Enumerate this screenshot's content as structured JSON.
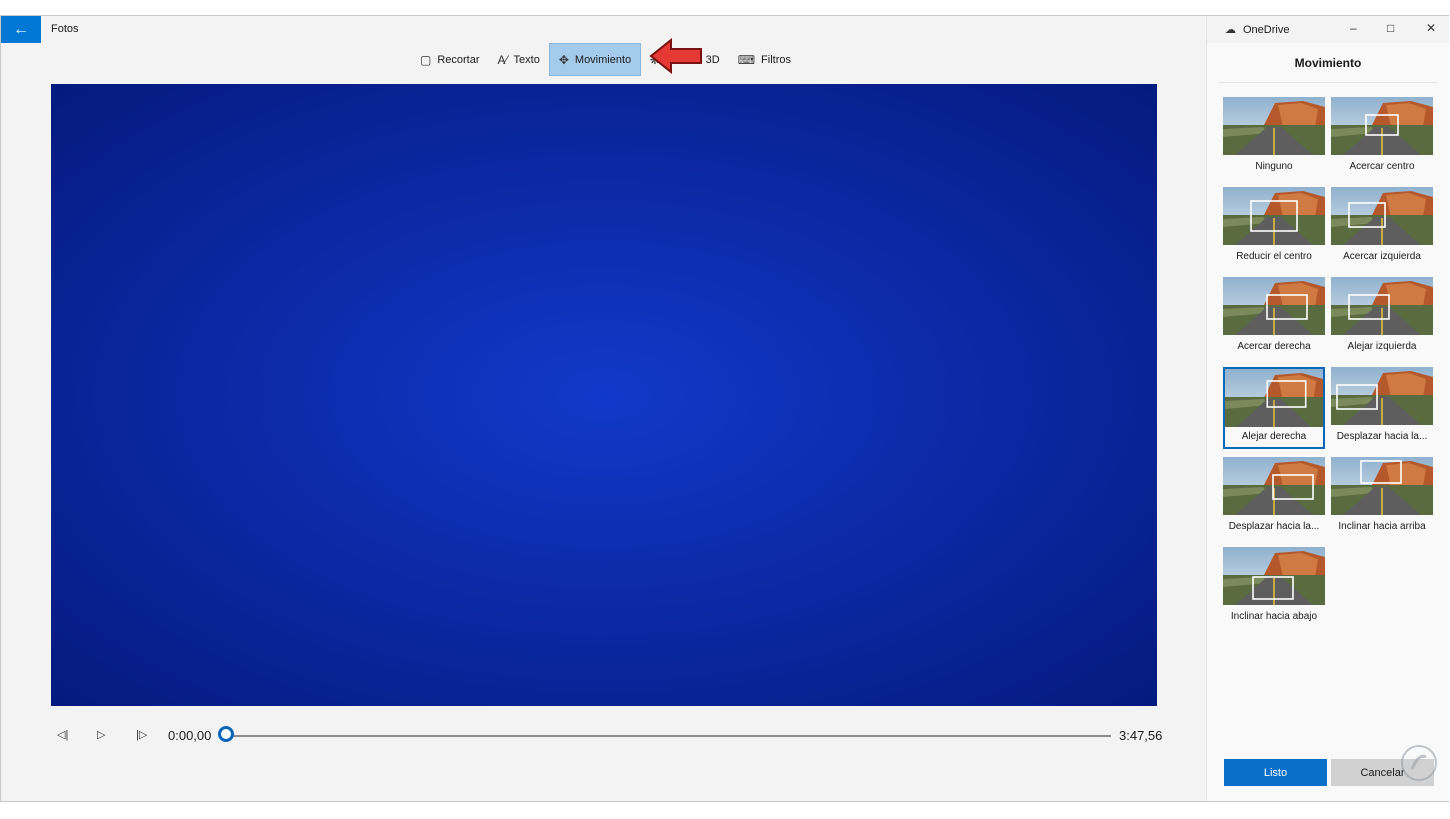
{
  "window": {
    "title": "Fotos"
  },
  "toolbar": {
    "items": [
      {
        "label": "Recortar",
        "icon": "crop-icon"
      },
      {
        "label": "Texto",
        "icon": "text-icon"
      },
      {
        "label": "Movimiento",
        "icon": "motion-icon",
        "active": true
      },
      {
        "label": "Efectos 3D",
        "icon": "effects-3d-icon"
      },
      {
        "label": "Filtros",
        "icon": "filter-brush-icon"
      }
    ]
  },
  "player": {
    "current_time": "0:00,00",
    "total_time": "3:47,56",
    "progress": 0.0,
    "video_color": "#0c2aa8"
  },
  "panel": {
    "app_label": "OneDrive",
    "title": "Movimiento",
    "items": [
      {
        "label": "Ninguno"
      },
      {
        "label": "Acercar centro"
      },
      {
        "label": "Reducir el centro"
      },
      {
        "label": "Acercar izquierda"
      },
      {
        "label": "Acercar derecha"
      },
      {
        "label": "Alejar izquierda"
      },
      {
        "label": "Alejar derecha",
        "selected": true
      },
      {
        "label": "Desplazar hacia la..."
      },
      {
        "label": "Desplazar hacia la..."
      },
      {
        "label": "Inclinar hacia arriba"
      },
      {
        "label": "Inclinar hacia abajo"
      }
    ],
    "done_label": "Listo",
    "cancel_label": "Cancelar"
  },
  "colors": {
    "accent": "#0078d4",
    "active_tab": "#a5cbec",
    "pointer": "#e53935"
  }
}
